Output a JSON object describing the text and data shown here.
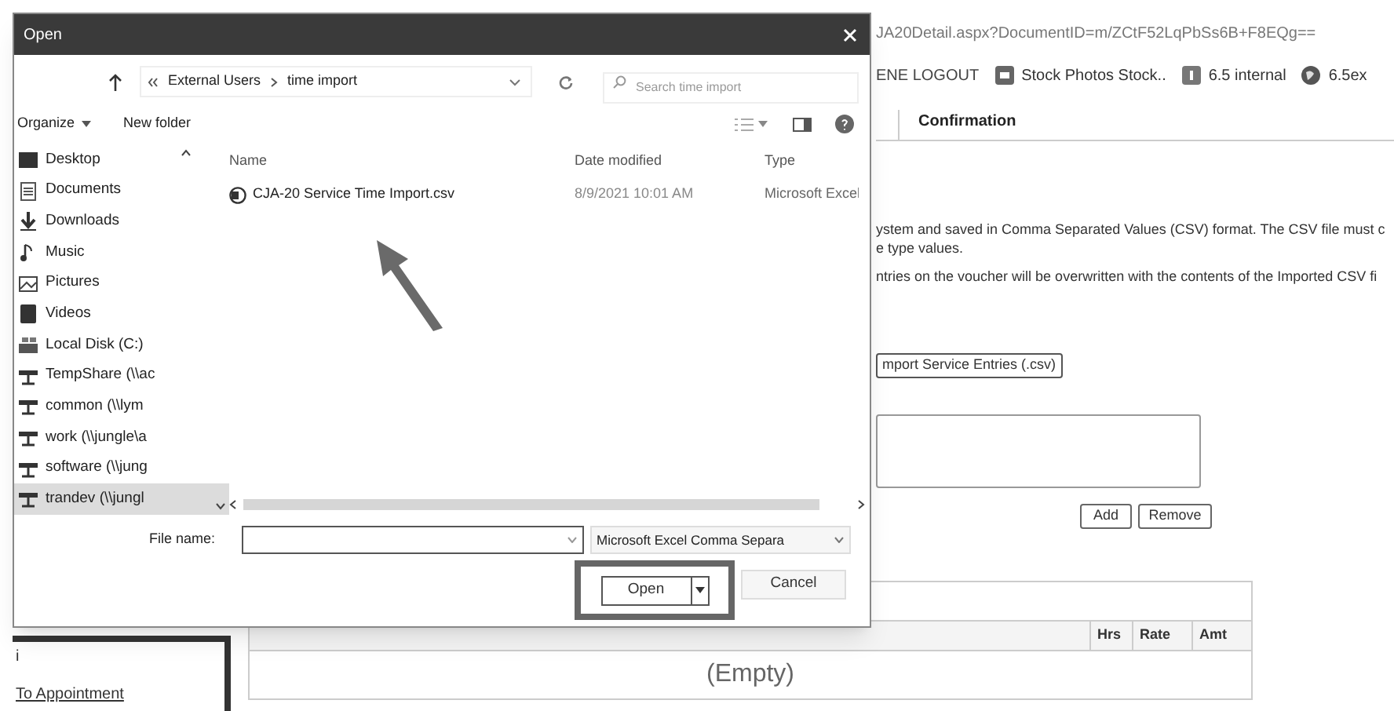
{
  "browser": {
    "url": "JA20Detail.aspx?DocumentID=m/ZCtF52LqPbSs6B+F8EQg==",
    "bookmarks": [
      {
        "label": "ENE LOGOUT",
        "kind": "text"
      },
      {
        "label": "Stock Photos  Stock..",
        "kind": "photo"
      },
      {
        "label": "6.5 internal",
        "kind": "page"
      },
      {
        "label": "6.5ex",
        "kind": "globe"
      }
    ]
  },
  "page": {
    "tabs": [
      {
        "label": "Confirmation",
        "selected": true
      }
    ],
    "instructions": [
      "ystem and saved in Comma Separated Values (CSV) format. The CSV file must c",
      "e type values.",
      "ntries on the voucher will be overwritten with the contents of the Imported CSV fi"
    ],
    "import_button": "mport Service Entries (.csv)",
    "add_button": "Add",
    "remove_button": "Remove",
    "table": {
      "columns": [
        "Hrs",
        "Rate",
        "Amt"
      ],
      "empty_text": "(Empty)"
    },
    "side_links": [
      "i",
      "To Appointment"
    ]
  },
  "dialog": {
    "title": "Open",
    "breadcrumb": [
      "External Users",
      "time import"
    ],
    "search": {
      "placeholder": "Search time import"
    },
    "toolbar": {
      "organize": "Organize",
      "new_folder": "New folder"
    },
    "nav_items": [
      {
        "label": "Desktop",
        "kind": "desktop",
        "selected": false
      },
      {
        "label": "Documents",
        "kind": "documents",
        "selected": false
      },
      {
        "label": "Downloads",
        "kind": "downloads",
        "selected": false
      },
      {
        "label": "Music",
        "kind": "music",
        "selected": false
      },
      {
        "label": "Pictures",
        "kind": "pictures",
        "selected": false
      },
      {
        "label": "Videos",
        "kind": "videos",
        "selected": false
      },
      {
        "label": "Local Disk (C:)",
        "kind": "disk",
        "selected": false
      },
      {
        "label": "TempShare (\\\\ac",
        "kind": "network",
        "selected": false
      },
      {
        "label": "common (\\\\lym",
        "kind": "network",
        "selected": false
      },
      {
        "label": "work (\\\\jungle\\a",
        "kind": "network",
        "selected": false
      },
      {
        "label": "software (\\\\jung",
        "kind": "network",
        "selected": false
      },
      {
        "label": "trandev (\\\\jungl",
        "kind": "network",
        "selected": true
      }
    ],
    "columns": [
      "Name",
      "Date modified",
      "Type"
    ],
    "files": [
      {
        "name": "CJA-20 Service Time Import.csv",
        "date": "8/9/2021 10:01 AM",
        "type": "Microsoft Excel"
      }
    ],
    "file_name_label": "File name:",
    "file_type": "Microsoft Excel Comma Separa",
    "open_button": "Open",
    "cancel_button": "Cancel"
  }
}
